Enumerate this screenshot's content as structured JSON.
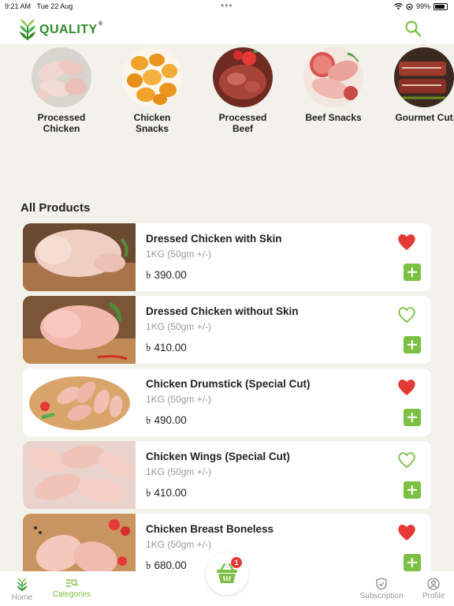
{
  "status": {
    "time": "9:21 AM",
    "date": "Tue 22 Aug",
    "battery": "99%"
  },
  "brand": {
    "name": "QUALITY",
    "mark": "®"
  },
  "categories": [
    {
      "label": "Processed Chicken"
    },
    {
      "label": "Chicken Snacks"
    },
    {
      "label": "Processed Beef"
    },
    {
      "label": "Beef Snacks"
    },
    {
      "label": "Gourmet Cut"
    }
  ],
  "section_title": "All Products",
  "products": [
    {
      "name": "Dressed Chicken with Skin",
      "weight": "1KG (50gm +/-)",
      "price": "৳ 390.00",
      "favorite": true
    },
    {
      "name": "Dressed Chicken without Skin",
      "weight": "1KG (50gm +/-)",
      "price": "৳ 410.00",
      "favorite": false
    },
    {
      "name": "Chicken Drumstick (Special Cut)",
      "weight": "1KG (50gm +/-)",
      "price": "৳ 490.00",
      "favorite": true
    },
    {
      "name": "Chicken Wings (Special Cut)",
      "weight": "1KG (50gm +/-)",
      "price": "৳ 410.00",
      "favorite": false
    },
    {
      "name": "Chicken Breast Boneless",
      "weight": "1KG (50gm +/-)",
      "price": "৳ 680.00",
      "favorite": true
    }
  ],
  "cart": {
    "count": "1"
  },
  "tabs": {
    "home": "Home",
    "categories": "Categories",
    "subscription": "Subscription",
    "profile": "Profile"
  },
  "colors": {
    "accent": "#7bc043",
    "brand": "#2f8a28",
    "heart": "#e53935",
    "background": "#f2f1eb"
  }
}
